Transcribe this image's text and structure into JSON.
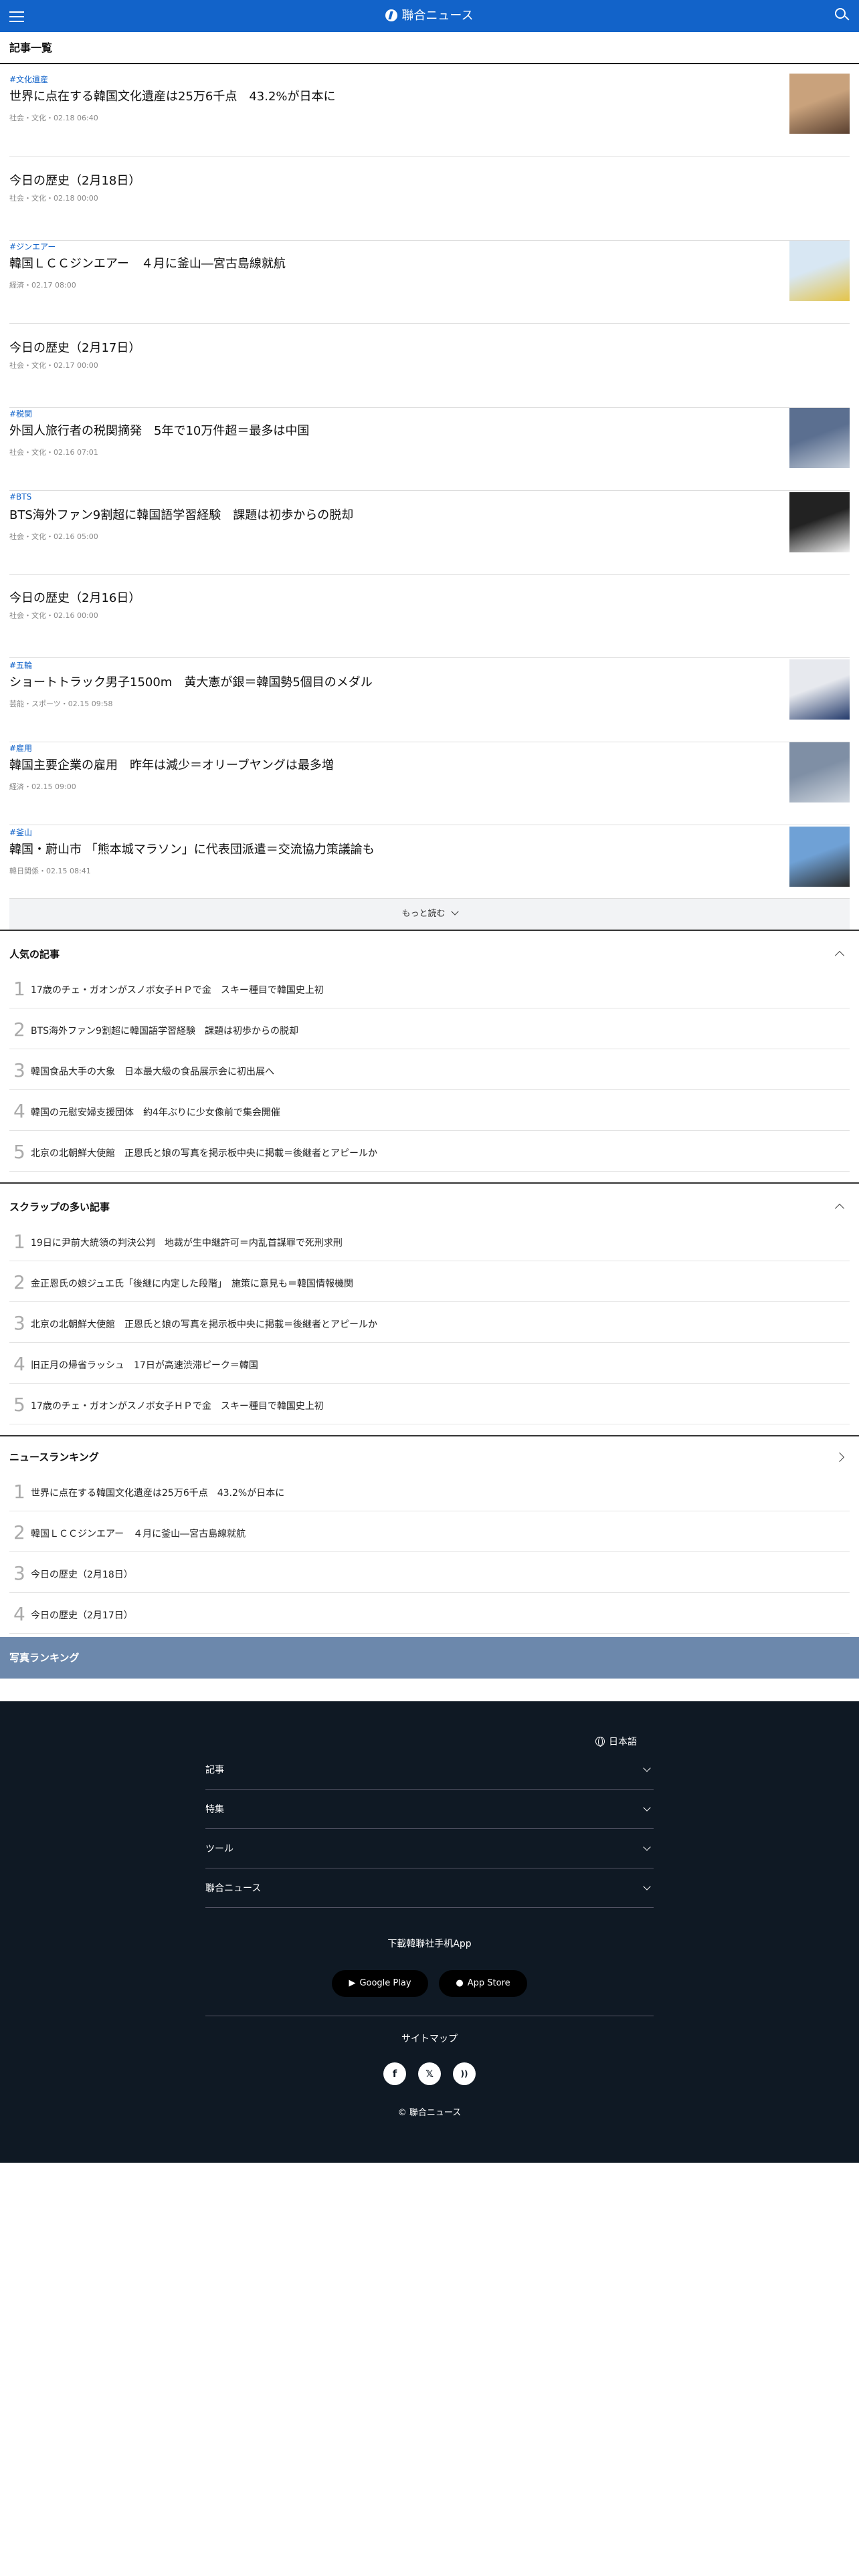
{
  "header": {
    "brand": "聯合ニュース"
  },
  "list_title": "記事一覧",
  "articles": [
    {
      "tag": "#文化遺産",
      "title": "世界に点在する韓国文化遺産は25万6千点　43.2%が日本に",
      "meta": "社会・文化・02.18 06:40",
      "thumb": true
    },
    {
      "tag": "",
      "title": "今日の歴史（2月18日）",
      "meta": "社会・文化・02.18 00:00",
      "thumb": false
    },
    {
      "tag": "#ジンエアー",
      "title": "韓国ＬＣＣジンエアー　４月に釜山―宮古島線就航",
      "meta": "経済・02.17 08:00",
      "thumb": true
    },
    {
      "tag": "",
      "title": "今日の歴史（2月17日）",
      "meta": "社会・文化・02.17 00:00",
      "thumb": false
    },
    {
      "tag": "#税関",
      "title": "外国人旅行者の税関摘発　5年で10万件超＝最多は中国",
      "meta": "社会・文化・02.16 07:01",
      "thumb": true
    },
    {
      "tag": "#BTS",
      "title": "BTS海外ファン9割超に韓国語学習経験　課題は初歩からの脱却",
      "meta": "社会・文化・02.16 05:00",
      "thumb": true
    },
    {
      "tag": "",
      "title": "今日の歴史（2月16日）",
      "meta": "社会・文化・02.16 00:00",
      "thumb": false
    },
    {
      "tag": "#五輪",
      "title": "ショートトラック男子1500m　黄大憲が銀＝韓国勢5個目のメダル",
      "meta": "芸能・スポーツ・02.15 09:58",
      "thumb": true
    },
    {
      "tag": "#雇用",
      "title": "韓国主要企業の雇用　昨年は減少＝オリーブヤングは最多増",
      "meta": "経済・02.15 09:00",
      "thumb": true
    },
    {
      "tag": "#釜山",
      "title": "韓国・蔚山市 「熊本城マラソン」に代表団派遣＝交流協力策議論も",
      "meta": "韓日関係・02.15 08:41",
      "thumb": true
    }
  ],
  "more_label": "もっと読む",
  "popular": {
    "title": "人気の記事",
    "items": [
      {
        "num": "1",
        "text": "17歳のチェ・ガオンがスノボ女子ＨＰで金　スキー種目で韓国史上初"
      },
      {
        "num": "2",
        "text": "BTS海外ファン9割超に韓国語学習経験　課題は初歩からの脱却"
      },
      {
        "num": "3",
        "text": "韓国食品大手の大象　日本最大級の食品展示会に初出展へ"
      },
      {
        "num": "4",
        "text": "韓国の元慰安婦支援団体　約4年ぶりに少女像前で集会開催"
      },
      {
        "num": "5",
        "text": "北京の北朝鮮大使館　正恩氏と娘の写真を掲示板中央に掲載＝後継者とアピールか"
      }
    ]
  },
  "scraps": {
    "title": "スクラップの多い記事",
    "items": [
      {
        "num": "1",
        "text": "19日に尹前大統領の判決公判　地裁が生中継許可＝内乱首謀罪で死刑求刑"
      },
      {
        "num": "2",
        "text": "金正恩氏の娘ジュエ氏「後継に内定した段階」　施策に意見も＝韓国情報機関"
      },
      {
        "num": "3",
        "text": "北京の北朝鮮大使館　正恩氏と娘の写真を掲示板中央に掲載＝後継者とアピールか"
      },
      {
        "num": "4",
        "text": "旧正月の帰省ラッシュ　17日が高速渋滞ピーク＝韓国"
      },
      {
        "num": "5",
        "text": "17歳のチェ・ガオンがスノボ女子ＨＰで金　スキー種目で韓国史上初"
      }
    ]
  },
  "news_ranking": {
    "title": "ニュースランキング",
    "items": [
      {
        "num": "1",
        "text": "世界に点在する韓国文化遺産は25万6千点　43.2%が日本に"
      },
      {
        "num": "2",
        "text": "韓国ＬＣＣジンエアー　４月に釜山―宮古島線就航"
      },
      {
        "num": "3",
        "text": "今日の歴史（2月18日）"
      },
      {
        "num": "4",
        "text": "今日の歴史（2月17日）"
      }
    ]
  },
  "photo_ranking": {
    "title": "写真ランキング"
  },
  "footer": {
    "language": "日本語",
    "menu": [
      "記事",
      "特集",
      "ツール",
      "聯合ニュース"
    ],
    "app_download": "下載韓聯社手机App",
    "google_play": "Google Play",
    "app_store": "App Store",
    "sitemap": "サイトマップ",
    "social": [
      "f",
      "X",
      "rss"
    ],
    "copyright": "© 聯合ニュース"
  },
  "colors": {
    "brand_blue": "#1263c9",
    "footer_bg": "#0f1924",
    "photo_bar": "#6c88ac"
  }
}
